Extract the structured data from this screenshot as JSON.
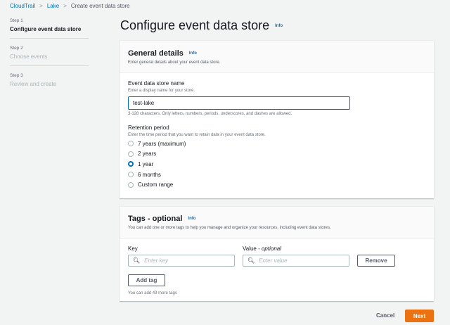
{
  "breadcrumb": {
    "items": [
      "CloudTrail",
      "Lake"
    ],
    "current": "Create event data store"
  },
  "steps": [
    {
      "num": "Step 1",
      "name": "Configure event data store"
    },
    {
      "num": "Step 2",
      "name": "Choose events"
    },
    {
      "num": "Step 3",
      "name": "Review and create"
    }
  ],
  "page": {
    "title": "Configure event data store",
    "info": "Info"
  },
  "general": {
    "title": "General details",
    "info": "Info",
    "desc": "Enter general details about your event data store.",
    "name_label": "Event data store name",
    "name_desc": "Enter a display name for your store.",
    "name_value": "test-lake",
    "name_hint": "3-128 characters. Only letters, numbers, periods, underscores, and dashes are allowed.",
    "retention_label": "Retention period",
    "retention_desc": "Enter the time period that you want to retain data in your event data store.",
    "retention_options": [
      "7 years (maximum)",
      "2 years",
      "1 year",
      "6 months",
      "Custom range"
    ],
    "retention_selected": "1 year"
  },
  "tags": {
    "title": "Tags - optional",
    "info": "Info",
    "desc": "You can add one or more tags to help you manage and organize your resources, including event data stores.",
    "key_label": "Key",
    "value_label": "Value - ",
    "value_label_em": "optional",
    "key_placeholder": "Enter key",
    "value_placeholder": "Enter value",
    "remove": "Remove",
    "add": "Add tag",
    "limit": "You can add 49 more tags"
  },
  "footer": {
    "cancel": "Cancel",
    "next": "Next",
    "accent": "#ec7211"
  }
}
